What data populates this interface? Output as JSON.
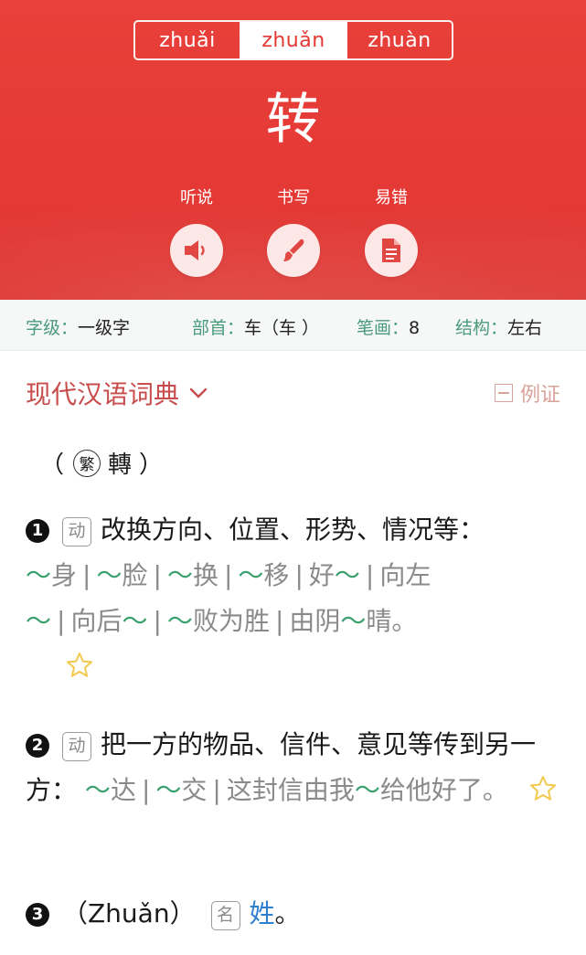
{
  "pinyin_tabs": [
    "zhuǎi",
    "zhuǎn",
    "zhuàn"
  ],
  "active_tab": 1,
  "character": "转",
  "actions": {
    "listen": "听说",
    "write": "书写",
    "mistakes": "易错"
  },
  "meta": {
    "level_key": "字级：",
    "level_val": "一级字",
    "radical_key": "部首：",
    "radical_val": "车（车 ）",
    "strokes_key": "笔画：",
    "strokes_val": "8",
    "structure_key": "结构：",
    "structure_val": "左右"
  },
  "dictionary": {
    "title": "现代汉语词典",
    "example_toggle": "例证",
    "traditional_open": "（",
    "traditional_mark": "繁",
    "traditional_char": "轉",
    "traditional_close": "）"
  },
  "definitions": [
    {
      "num": "1",
      "pos": "动",
      "text": "改换方向、位置、形势、情况等：",
      "examples": [
        "身",
        "脸",
        "换",
        "移",
        "好",
        "向左",
        "向后",
        "败为胜",
        "由阴晴。"
      ]
    },
    {
      "num": "2",
      "pos": "动",
      "text": "把一方的物品、信件、意见等传到另一方：",
      "examples": [
        "达",
        "交",
        "这封信由我",
        "给他好了。"
      ]
    },
    {
      "num": "3",
      "reading": "（Zhuǎn）",
      "pos": "名",
      "text": "姓",
      "end": "。"
    }
  ],
  "tilde": "～",
  "colors": {
    "hero_red": "#e53935",
    "meta_key_green": "#4a9a7c",
    "dict_title_red": "#c94c4c",
    "tilde_green": "#3aa06e",
    "link_blue": "#2f7fd0",
    "star_yellow": "#f2c94c"
  }
}
